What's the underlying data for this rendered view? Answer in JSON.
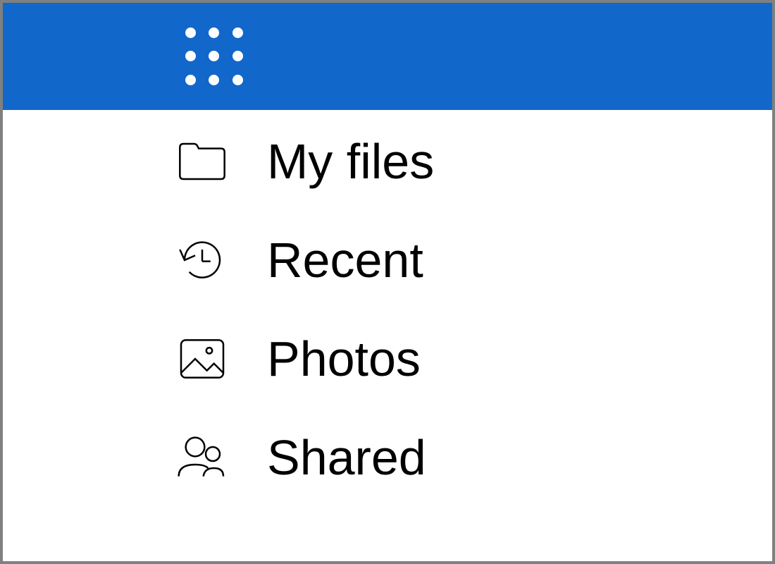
{
  "header": {
    "brand_color": "#1267cb"
  },
  "nav": {
    "items": [
      {
        "icon": "folder-icon",
        "label": "My files"
      },
      {
        "icon": "recent-icon",
        "label": "Recent"
      },
      {
        "icon": "photos-icon",
        "label": "Photos"
      },
      {
        "icon": "shared-icon",
        "label": "Shared"
      }
    ]
  }
}
